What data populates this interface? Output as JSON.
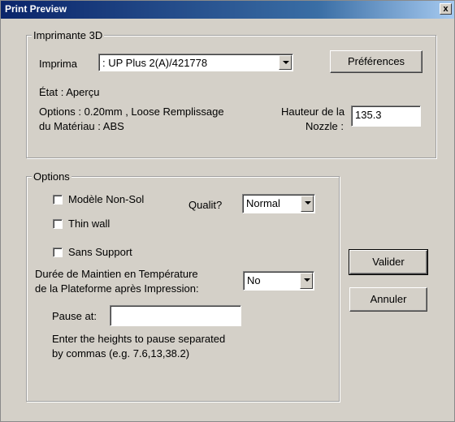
{
  "window": {
    "title": "Print Preview",
    "close_label": "x"
  },
  "printer_group": {
    "legend": "Imprimante 3D",
    "printer_label": "Imprima",
    "printer_value": ": UP Plus 2(A)/421778",
    "preferences_label": "Préférences",
    "state_text": "État : Aperçu",
    "options_line1": "Options : 0.20mm , Loose Remplissage",
    "options_line2": "du Matériau : ABS",
    "nozzle_label_line1": "Hauteur de la",
    "nozzle_label_line2": "Nozzle :",
    "nozzle_value": "135.3"
  },
  "options_group": {
    "legend": "Options",
    "non_sol_label": "Modèle Non-Sol",
    "thin_wall_label": "Thin wall",
    "sans_support_label": "Sans Support",
    "quality_label": "Qualit?",
    "quality_value": "Normal",
    "hold_label_line1": "Durée de Maintien en Température",
    "hold_label_line2": "de la Plateforme après Impression:",
    "hold_value": "No",
    "pause_label": "Pause at:",
    "pause_value": "",
    "hint_line1": "Enter the heights to pause separated",
    "hint_line2": "by commas (e.g. 7.6,13,38.2)"
  },
  "buttons": {
    "ok_label": "Valider",
    "cancel_label": "Annuler"
  }
}
